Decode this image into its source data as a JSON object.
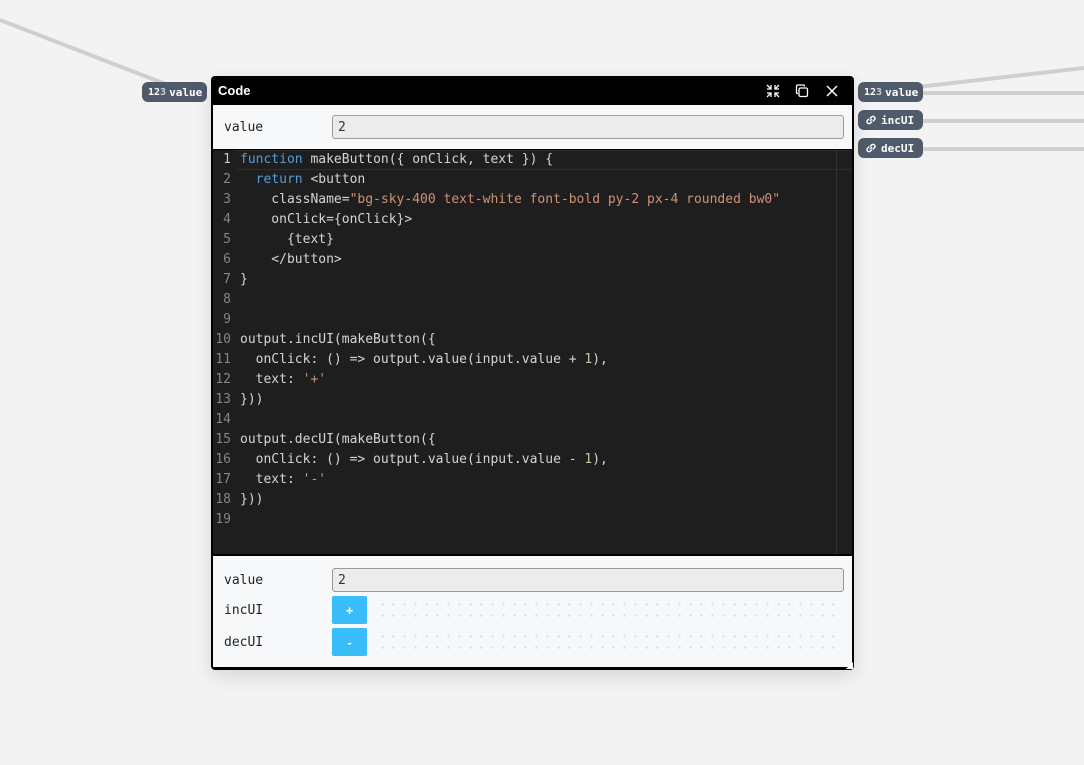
{
  "node": {
    "title": "Code",
    "icons": [
      "compress-icon",
      "duplicate-icon",
      "close-icon"
    ]
  },
  "ports": {
    "input_value": {
      "prefix_a": "12",
      "prefix_b": "3",
      "label": "value"
    },
    "output_value": {
      "prefix_a": "12",
      "prefix_b": "3",
      "label": "value"
    },
    "output_incUI": {
      "label": "incUI"
    },
    "output_decUI": {
      "label": "decUI"
    }
  },
  "inputs": {
    "value_label": "value",
    "value": "2"
  },
  "code_lines": [
    {
      "n": "1",
      "segments": [
        {
          "t": "function",
          "c": "kw"
        },
        {
          "t": " makeButton({ onClick, text }) {",
          "c": ""
        }
      ]
    },
    {
      "n": "2",
      "segments": [
        {
          "t": "  ",
          "c": ""
        },
        {
          "t": "return",
          "c": "kw"
        },
        {
          "t": " <button",
          "c": ""
        }
      ]
    },
    {
      "n": "3",
      "segments": [
        {
          "t": "    className=",
          "c": ""
        },
        {
          "t": "\"bg-sky-400 text-white font-bold py-2 px-4 rounded bw0\"",
          "c": "str"
        }
      ]
    },
    {
      "n": "4",
      "segments": [
        {
          "t": "    onClick={onClick}>",
          "c": ""
        }
      ]
    },
    {
      "n": "5",
      "segments": [
        {
          "t": "      {text}",
          "c": ""
        }
      ]
    },
    {
      "n": "6",
      "segments": [
        {
          "t": "    </button>",
          "c": ""
        }
      ]
    },
    {
      "n": "7",
      "segments": [
        {
          "t": "}",
          "c": ""
        }
      ]
    },
    {
      "n": "8",
      "segments": []
    },
    {
      "n": "9",
      "segments": []
    },
    {
      "n": "10",
      "segments": [
        {
          "t": "output.incUI(makeButton({",
          "c": ""
        }
      ]
    },
    {
      "n": "11",
      "segments": [
        {
          "t": "  onClick: () => output.value(input.value + ",
          "c": ""
        },
        {
          "t": "1",
          "c": "numc"
        },
        {
          "t": "),",
          "c": ""
        }
      ]
    },
    {
      "n": "12",
      "segments": [
        {
          "t": "  text: ",
          "c": ""
        },
        {
          "t": "'+'",
          "c": "str"
        }
      ]
    },
    {
      "n": "13",
      "segments": [
        {
          "t": "}))",
          "c": ""
        }
      ]
    },
    {
      "n": "14",
      "segments": []
    },
    {
      "n": "15",
      "segments": [
        {
          "t": "output.decUI(makeButton({",
          "c": ""
        }
      ]
    },
    {
      "n": "16",
      "segments": [
        {
          "t": "  onClick: () => output.value(input.value - ",
          "c": ""
        },
        {
          "t": "1",
          "c": "numc"
        },
        {
          "t": "),",
          "c": ""
        }
      ]
    },
    {
      "n": "17",
      "segments": [
        {
          "t": "  text: ",
          "c": ""
        },
        {
          "t": "'-'",
          "c": "str"
        }
      ]
    },
    {
      "n": "18",
      "segments": [
        {
          "t": "}))",
          "c": ""
        }
      ]
    },
    {
      "n": "19",
      "segments": []
    }
  ],
  "outputs": {
    "value_label": "value",
    "value": "2",
    "incUI_label": "incUI",
    "incUI_button": "+",
    "decUI_label": "decUI",
    "decUI_button": "-"
  },
  "colors": {
    "canvas": "#f3f3f3",
    "node_frame": "#000000",
    "port": "#4f5b6b",
    "button": "#38bdf8",
    "editor_bg": "#1e1e1e",
    "keyword": "#569cd6",
    "string": "#ce9178",
    "number": "#b5cea8"
  }
}
